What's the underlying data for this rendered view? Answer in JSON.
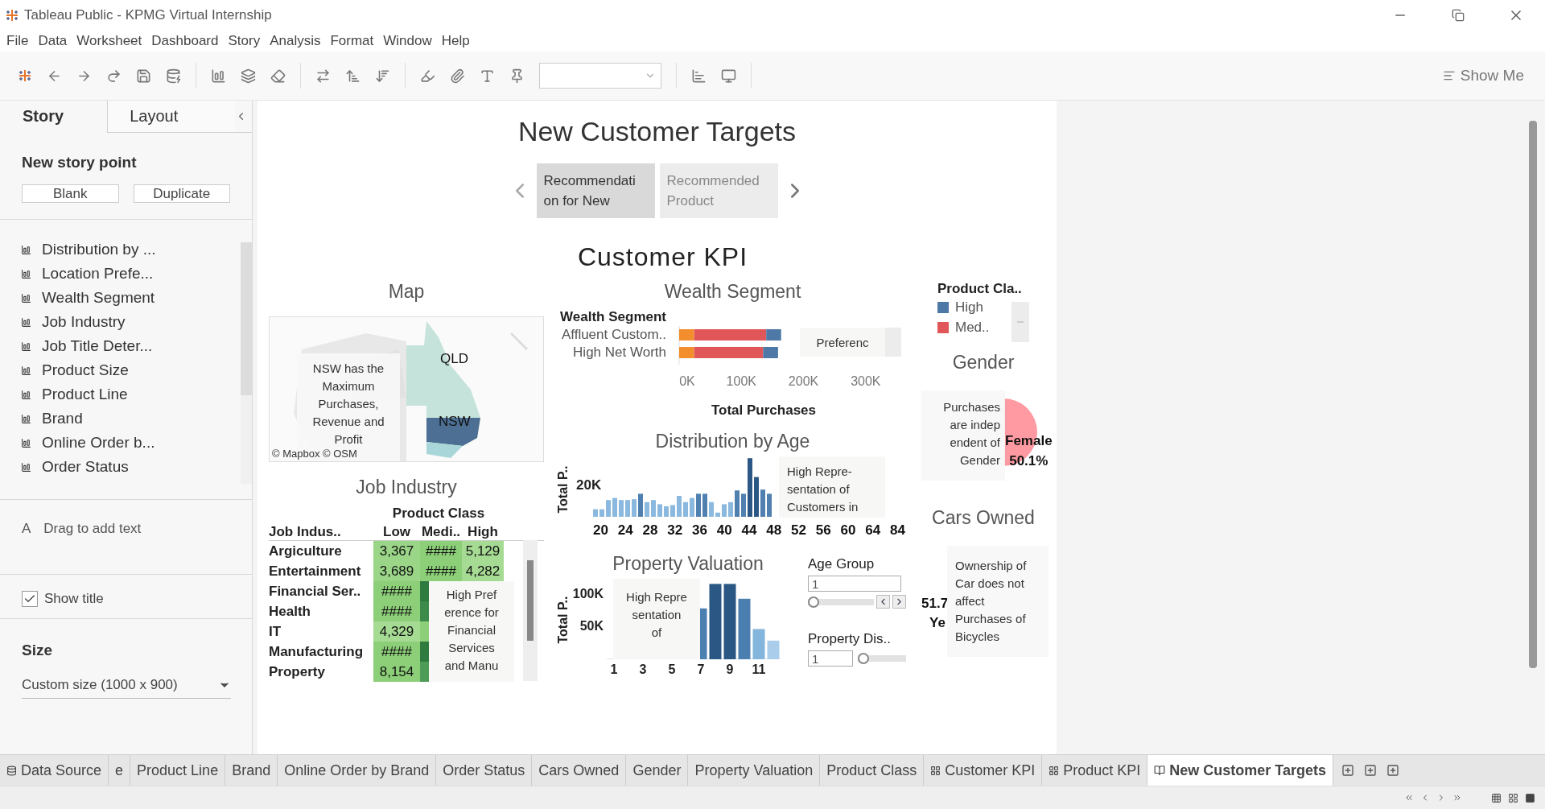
{
  "window": {
    "title": "Tableau Public - KPMG Virtual Internship"
  },
  "menu": [
    "File",
    "Data",
    "Worksheet",
    "Dashboard",
    "Story",
    "Analysis",
    "Format",
    "Window",
    "Help"
  ],
  "toolbar": {
    "show_me": "Show Me"
  },
  "story_panel": {
    "tabs": [
      {
        "label": "Story",
        "selected": true
      },
      {
        "label": "Layout",
        "selected": false
      }
    ],
    "new_point_heading": "New story point",
    "buttons": [
      "Blank",
      "Duplicate"
    ],
    "sheets": [
      "Distribution by ...",
      "Location Prefe...",
      "Wealth Segment",
      "Job Industry",
      "Job Title Deter...",
      "Product Size",
      "Product Line",
      "Brand",
      "Online Order b...",
      "Order Status"
    ],
    "text_icon": "A",
    "text_hint": "Drag to add text",
    "show_title": {
      "label": "Show title",
      "checked": true
    },
    "size_heading": "Size",
    "size_value": "Custom size (1000 x 900)"
  },
  "dashboard": {
    "title": "New Customer Targets",
    "story_points": [
      {
        "label": "Recommendati\non for New",
        "selected": true
      },
      {
        "label": "Recommended\nProduct",
        "selected": false
      }
    ],
    "kpi_title": "Customer KPI",
    "map": {
      "title": "Map",
      "labels": [
        "QLD",
        "NSW"
      ],
      "note": "NSW has the\nMaximum\nPurchases,\nRevenue and\nProfit",
      "attribution": "© Mapbox © OSM"
    },
    "job_industry": {
      "title": "Job Industry",
      "header": "Product Class",
      "row_header": "Job Indus..",
      "columns": [
        "Low",
        "Medi..",
        "High"
      ],
      "rows": [
        {
          "name": "Argiculture",
          "cells": [
            {
              "text": "3,367",
              "color": "#9bd688"
            },
            {
              "text": "####",
              "color": "#8ccf78"
            },
            {
              "text": "5,129",
              "color": "#a6db94"
            }
          ]
        },
        {
          "name": "Entertainment",
          "cells": [
            {
              "text": "3,689",
              "color": "#9bd688"
            },
            {
              "text": "####",
              "color": "#8ccf78"
            },
            {
              "text": "4,282",
              "color": "#a6db94"
            }
          ]
        },
        {
          "name": "Financial Ser..",
          "cells": [
            {
              "text": "####",
              "color": "#8ccf78"
            },
            {
              "color": "#2f7a3f"
            },
            {}
          ]
        },
        {
          "name": "Health",
          "cells": [
            {
              "text": "####",
              "color": "#8ccf78"
            },
            {
              "color": "#3d8a4a"
            },
            {}
          ]
        },
        {
          "name": "IT",
          "cells": [
            {
              "text": "4,329",
              "color": "#a6db94"
            },
            {
              "color": "#8ccf78"
            },
            {}
          ]
        },
        {
          "name": "Manufacturing",
          "cells": [
            {
              "text": "####",
              "color": "#8ccf78"
            },
            {
              "color": "#2f7a3f"
            },
            {}
          ]
        },
        {
          "name": "Property",
          "cells": [
            {
              "text": "8,154",
              "color": "#8ccf78"
            },
            {
              "color": "#4e9c55"
            },
            {}
          ]
        }
      ],
      "note": "High Pref\nerence for\nFinancial\nServices\nand Manu"
    },
    "wealth": {
      "title": "Wealth Segment",
      "note": "Preferenc",
      "chart_data": {
        "type": "bar",
        "orientation": "horizontal",
        "stacked": true,
        "ylabel": "Wealth Segment",
        "xlabel": "Total Purchases",
        "categories": [
          "Affluent Custom..",
          "High Net Worth"
        ],
        "series": [
          {
            "color": "#f28e2b",
            "values": [
              24000,
              24000
            ]
          },
          {
            "name": "Med..",
            "color": "#e15759",
            "values": [
              116000,
              111000
            ]
          },
          {
            "name": "High",
            "color": "#4e79a7",
            "values": [
              24000,
              24000
            ]
          }
        ],
        "xlim": [
          0,
          330000
        ],
        "xticks": [
          {
            "value": 0,
            "label": "0K"
          },
          {
            "value": 100000,
            "label": "100K"
          },
          {
            "value": 200000,
            "label": "200K"
          },
          {
            "value": 300000,
            "label": "300K"
          }
        ]
      }
    },
    "legend": {
      "title": "Product Cla.."
    },
    "age": {
      "title": "Distribution by Age",
      "ylabel": "Total P..",
      "ytick": "20K",
      "xlabels": [
        "20",
        "24",
        "28",
        "32",
        "36",
        "40",
        "44",
        "48",
        "52",
        "56",
        "60",
        "64",
        "84"
      ],
      "note": "High Repre-\nsentation of\nCustomers in"
    },
    "property": {
      "title": "Property Valuation",
      "note": "High Repre\nsentation\nof",
      "chart_data": {
        "type": "bar",
        "ylabel": "Total P..",
        "x": [
          7,
          8,
          9,
          10,
          11,
          12
        ],
        "values": [
          79000,
          117000,
          117000,
          94000,
          47000,
          29000
        ],
        "xlim": [
          0.5,
          12.5
        ],
        "ylim": [
          0,
          125000
        ],
        "yticks": [
          {
            "value": 50000,
            "label": "50K"
          },
          {
            "value": 100000,
            "label": "100K"
          }
        ],
        "xticks": [
          1,
          3,
          5,
          7,
          9,
          11
        ]
      }
    },
    "filters": [
      {
        "kind": "stepper",
        "label": "Age Group",
        "value": "1",
        "level": 0
      },
      {
        "kind": "plain",
        "label": "Property Dis..",
        "value": "1",
        "level": 0
      }
    ],
    "gender": {
      "title": "Gender",
      "note": "Purchases\nare indep\nendent of\nGender",
      "label": "Female\n50.1%"
    },
    "cars": {
      "title": "Cars Owned",
      "note": "Ownership of\nCar does not\naffect\nPurchases of\nBicycles",
      "labels": [
        "51.7",
        "Ye"
      ]
    }
  },
  "sheet_tabs": [
    {
      "kind": "datasource",
      "label": "Data Source",
      "selected": false
    },
    {
      "kind": "sheet",
      "label": "e",
      "selected": false
    },
    {
      "kind": "sheet",
      "label": "Product Line",
      "selected": false
    },
    {
      "kind": "sheet",
      "label": "Brand",
      "selected": false
    },
    {
      "kind": "sheet",
      "label": "Online Order by Brand",
      "selected": false
    },
    {
      "kind": "sheet",
      "label": "Order Status",
      "selected": false
    },
    {
      "kind": "sheet",
      "label": "Cars Owned",
      "selected": false
    },
    {
      "kind": "sheet",
      "label": "Gender",
      "selected": false
    },
    {
      "kind": "sheet",
      "label": "Property Valuation",
      "selected": false
    },
    {
      "kind": "sheet",
      "label": "Product Class",
      "selected": false
    },
    {
      "kind": "dashboard",
      "label": "Customer KPI",
      "selected": false
    },
    {
      "kind": "dashboard",
      "label": "Product KPI",
      "selected": false
    },
    {
      "kind": "story",
      "label": "New Customer Targets",
      "selected": true
    }
  ]
}
